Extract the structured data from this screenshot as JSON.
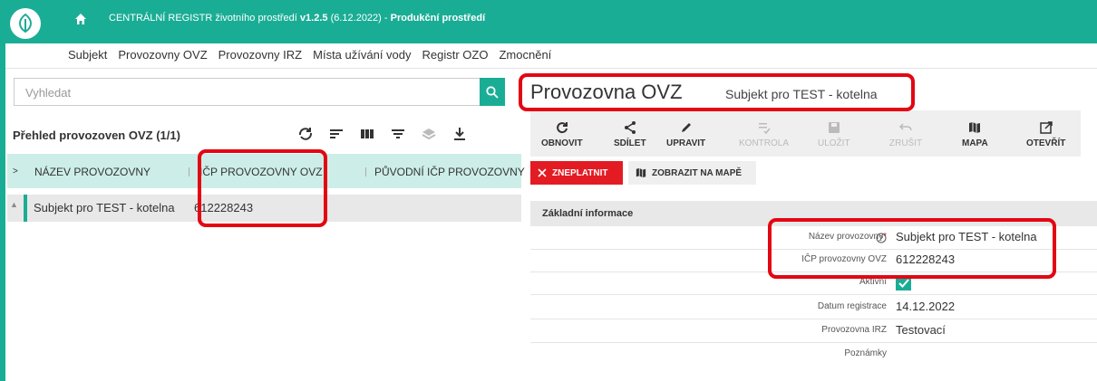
{
  "app": {
    "title_prefix": "CENTRÁLNÍ REGISTR ",
    "title_mid": "životního prostředí ",
    "version": "v1.2.5",
    "date": " (6.12.2022) - ",
    "environment": "Produkční prostředí"
  },
  "nav": [
    "Subjekt",
    "Provozovny OVZ",
    "Provozovny IRZ",
    "Místa užívání vody",
    "Registr OZO",
    "Zmocnění"
  ],
  "search": {
    "placeholder": "Vyhledat"
  },
  "list": {
    "title": "Přehled provozoven OVZ (1/1)",
    "columns": [
      "NÁZEV PROVOZOVNY",
      "IČP PROVOZOVNY OVZ",
      "PŮVODNÍ IČP PROVOZOVNY"
    ],
    "rows": [
      {
        "name": "Subjekt pro TEST - kotelna",
        "icp": "612228243"
      }
    ]
  },
  "detail": {
    "title": "Provozovna OVZ",
    "subtitle": "Subjekt pro TEST - kotelna",
    "actions": [
      "OBNOVIT",
      "SDÍLET",
      "UPRAVIT",
      "KONTROLA",
      "ULOŽIT",
      "ZRUŠIT",
      "MAPA",
      "OTEVŘÍT"
    ],
    "btn_invalidate": "ZNEPLATNIT",
    "btn_map": "ZOBRAZIT NA MAPĚ",
    "section": "Základní informace",
    "fields": {
      "name_label": "Název provozovny",
      "name_required": "*",
      "name_value": "Subjekt pro TEST - kotelna",
      "icp_label": "IČP provozovny OVZ",
      "icp_value": "612228243",
      "active_label": "Aktivní",
      "reg_label": "Datum registrace",
      "reg_value": "14.12.2022",
      "irz_label": "Provozovna IRZ",
      "irz_value": "Testovací",
      "notes_label": "Poznámky"
    }
  },
  "colors": {
    "accent": "#1aad95",
    "danger": "#e31b23",
    "highlight": "#e30613"
  }
}
